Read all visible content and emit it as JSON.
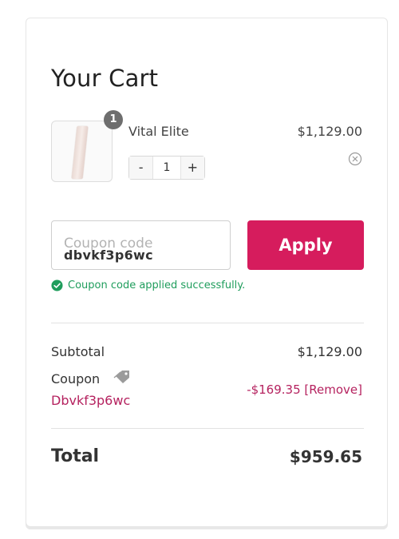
{
  "cart": {
    "title": "Your Cart"
  },
  "item": {
    "name": "Vital Elite",
    "price": "$1,129.00",
    "quantity": "1",
    "badge_count": "1",
    "decrement_label": "-",
    "increment_label": "+",
    "thumbnail_icon": "product-image",
    "remove_icon": "close-circle-icon"
  },
  "coupon_form": {
    "placeholder": "Coupon code",
    "value": "dbvkf3p6wc",
    "apply_label": "Apply",
    "success_message": "Coupon code applied successfully.",
    "success_icon": "check-circle-icon"
  },
  "summary": {
    "subtotal_label": "Subtotal",
    "subtotal_value": "$1,129.00",
    "coupon_label": "Coupon",
    "coupon_icon": "tag-icon",
    "coupon_code": "Dbvkf3p6wc",
    "discount_value": "-$169.35",
    "remove_label": "[Remove]",
    "total_label": "Total",
    "total_value": "$959.65"
  },
  "colors": {
    "accent": "#d61c5d",
    "link": "#b5225f",
    "success": "#1f9d5c",
    "badge": "#6e6e6e"
  }
}
